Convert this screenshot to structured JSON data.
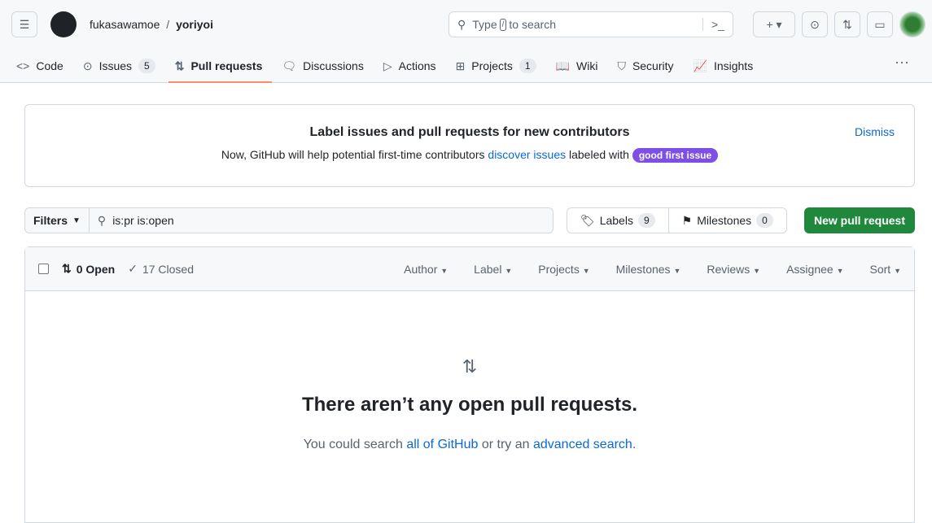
{
  "header": {
    "owner": "fukasawamoe",
    "repo": "yoriyoi",
    "search_before": "Type",
    "search_key": "/",
    "search_after": "to search"
  },
  "tabs": [
    {
      "label": "Code",
      "icon": "code-icon",
      "glyph": "<>"
    },
    {
      "label": "Issues",
      "icon": "issue-icon",
      "glyph": "⊙",
      "count": "5"
    },
    {
      "label": "Pull requests",
      "icon": "git-pull-request-icon",
      "glyph": "⇅"
    },
    {
      "label": "Discussions",
      "icon": "comment-discussion-icon",
      "glyph": "🗨"
    },
    {
      "label": "Actions",
      "icon": "play-icon",
      "glyph": "▷"
    },
    {
      "label": "Projects",
      "icon": "table-icon",
      "glyph": "⊞",
      "count": "1"
    },
    {
      "label": "Wiki",
      "icon": "book-icon",
      "glyph": "📖"
    },
    {
      "label": "Security",
      "icon": "shield-icon",
      "glyph": "⛉"
    },
    {
      "label": "Insights",
      "icon": "graph-icon",
      "glyph": "📈"
    }
  ],
  "banner": {
    "title": "Label issues and pull requests for new contributors",
    "text_before": "Now, GitHub will help potential first-time contributors",
    "link": "discover issues",
    "text_after": "labeled with",
    "label": "good first issue",
    "dismiss": "Dismiss"
  },
  "filterbar": {
    "filters": "Filters",
    "query": "is:pr is:open",
    "labels": "Labels",
    "labels_count": "9",
    "milestones": "Milestones",
    "milestones_count": "0",
    "new_pr": "New pull request"
  },
  "list": {
    "open": "0 Open",
    "closed": "17 Closed",
    "menus": [
      "Author",
      "Label",
      "Projects",
      "Milestones",
      "Reviews",
      "Assignee",
      "Sort"
    ]
  },
  "empty": {
    "title": "There aren’t any open pull requests.",
    "before": "You could search",
    "link1": "all of GitHub",
    "middle": "or try an",
    "link2": "advanced search",
    "after": "."
  },
  "colors": {
    "accent": "#0969da",
    "primary_button": "#1f883d",
    "label": "#7d4ee8",
    "tab_underline": "#fd8c73"
  }
}
